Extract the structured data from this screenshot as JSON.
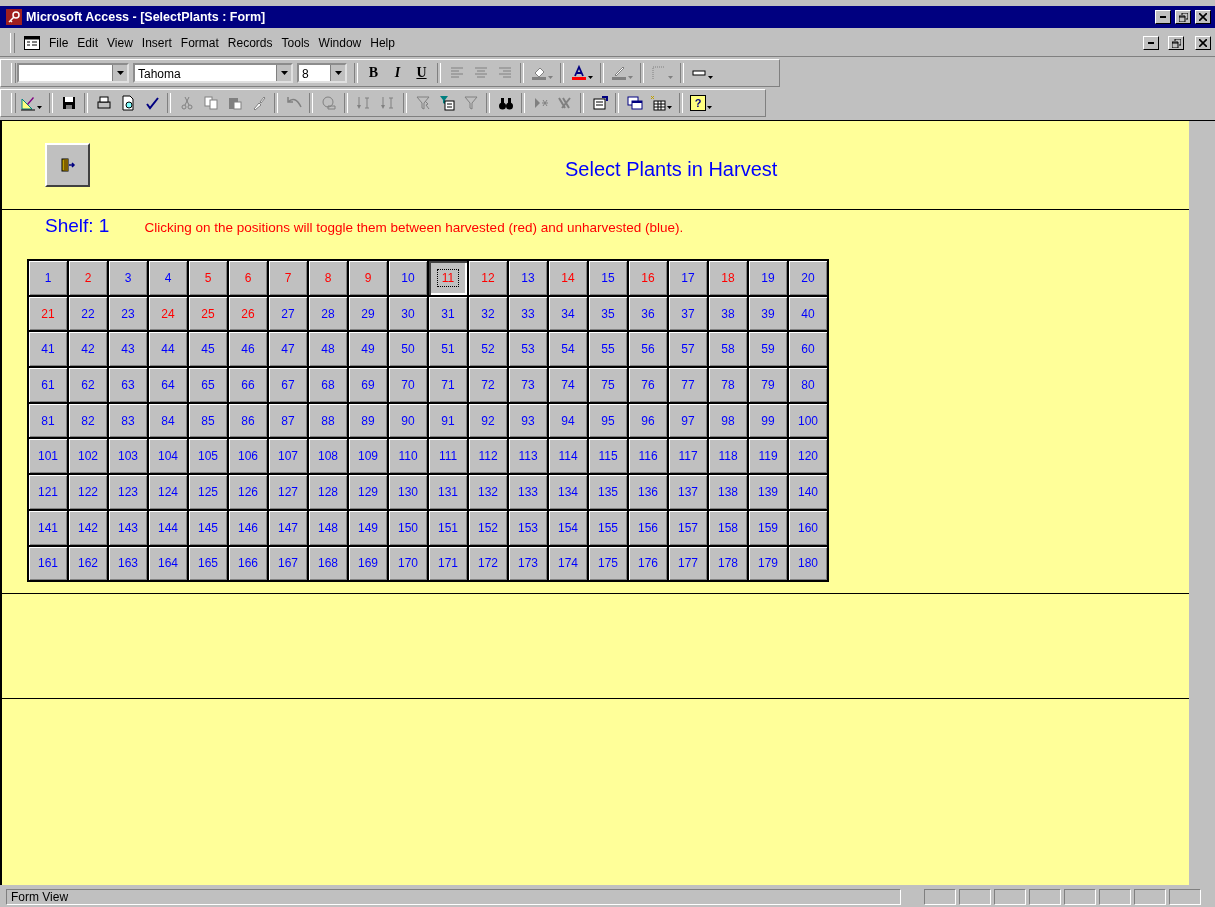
{
  "window": {
    "title": "Microsoft Access - [SelectPlants : Form]"
  },
  "menu": [
    "File",
    "Edit",
    "View",
    "Insert",
    "Format",
    "Records",
    "Tools",
    "Window",
    "Help"
  ],
  "formatting_toolbar": {
    "font_box": {
      "value": "Tahoma"
    },
    "size_box": {
      "value": "8"
    },
    "buttons": [
      {
        "kind": "bold",
        "glyph": "B",
        "disabled": false
      },
      {
        "kind": "italic",
        "glyph": "I",
        "disabled": false
      },
      {
        "kind": "underline",
        "glyph": "U",
        "disabled": false
      },
      {
        "kind": "separator"
      },
      {
        "kind": "align-left",
        "disabled": true
      },
      {
        "kind": "align-center",
        "disabled": true
      },
      {
        "kind": "align-right",
        "disabled": true
      },
      {
        "kind": "separator"
      },
      {
        "kind": "fill-color",
        "disabled": true
      },
      {
        "kind": "separator"
      },
      {
        "kind": "font-color",
        "disabled": false
      },
      {
        "kind": "separator"
      },
      {
        "kind": "line-color",
        "disabled": true
      },
      {
        "kind": "separator"
      },
      {
        "kind": "border",
        "disabled": true
      },
      {
        "kind": "separator"
      },
      {
        "kind": "special-effect",
        "disabled": false
      }
    ]
  },
  "form_toolbar": [
    {
      "kind": "view",
      "disabled": false
    },
    {
      "kind": "separator"
    },
    {
      "kind": "save",
      "disabled": false
    },
    {
      "kind": "separator"
    },
    {
      "kind": "print",
      "disabled": false
    },
    {
      "kind": "preview",
      "disabled": false
    },
    {
      "kind": "spelling",
      "disabled": false
    },
    {
      "kind": "separator"
    },
    {
      "kind": "cut",
      "disabled": true
    },
    {
      "kind": "copy",
      "disabled": true
    },
    {
      "kind": "paste",
      "disabled": true
    },
    {
      "kind": "brush",
      "disabled": true
    },
    {
      "kind": "separator"
    },
    {
      "kind": "undo",
      "disabled": true
    },
    {
      "kind": "separator"
    },
    {
      "kind": "hyperlink",
      "disabled": true
    },
    {
      "kind": "separator"
    },
    {
      "kind": "sort-ascending",
      "disabled": true
    },
    {
      "kind": "sort-descending",
      "disabled": true
    },
    {
      "kind": "separator"
    },
    {
      "kind": "filter-selection",
      "disabled": true
    },
    {
      "kind": "filter-form",
      "disabled": false
    },
    {
      "kind": "filter",
      "disabled": true
    },
    {
      "kind": "separator"
    },
    {
      "kind": "find",
      "disabled": false
    },
    {
      "kind": "separator"
    },
    {
      "kind": "new-record",
      "disabled": true
    },
    {
      "kind": "delete-record",
      "disabled": true
    },
    {
      "kind": "separator"
    },
    {
      "kind": "properties",
      "disabled": false
    },
    {
      "kind": "separator"
    },
    {
      "kind": "database-window",
      "disabled": false
    },
    {
      "kind": "new-object",
      "disabled": false
    },
    {
      "kind": "separator"
    },
    {
      "kind": "help",
      "glyph": "?",
      "disabled": false
    }
  ],
  "form": {
    "title": "Select Plants in Harvest",
    "shelf_label": "Shelf: 1",
    "instructions": "Clicking on the positions will toggle them between harvested (red) and unharvested (blue).",
    "positions": [
      {
        "label": "1",
        "harvested": false,
        "focused": false
      },
      {
        "label": "2",
        "harvested": true,
        "focused": false
      },
      {
        "label": "3",
        "harvested": false,
        "focused": false
      },
      {
        "label": "4",
        "harvested": false,
        "focused": false
      },
      {
        "label": "5",
        "harvested": true,
        "focused": false
      },
      {
        "label": "6",
        "harvested": true,
        "focused": false
      },
      {
        "label": "7",
        "harvested": true,
        "focused": false
      },
      {
        "label": "8",
        "harvested": true,
        "focused": false
      },
      {
        "label": "9",
        "harvested": true,
        "focused": false
      },
      {
        "label": "10",
        "harvested": false,
        "focused": false
      },
      {
        "label": "11",
        "harvested": true,
        "focused": true
      },
      {
        "label": "12",
        "harvested": true,
        "focused": false
      },
      {
        "label": "13",
        "harvested": false,
        "focused": false
      },
      {
        "label": "14",
        "harvested": true,
        "focused": false
      },
      {
        "label": "15",
        "harvested": false,
        "focused": false
      },
      {
        "label": "16",
        "harvested": true,
        "focused": false
      },
      {
        "label": "17",
        "harvested": false,
        "focused": false
      },
      {
        "label": "18",
        "harvested": true,
        "focused": false
      },
      {
        "label": "19",
        "harvested": false,
        "focused": false
      },
      {
        "label": "20",
        "harvested": false,
        "focused": false
      },
      {
        "label": "21",
        "harvested": true,
        "focused": false
      },
      {
        "label": "22",
        "harvested": false,
        "focused": false
      },
      {
        "label": "23",
        "harvested": false,
        "focused": false
      },
      {
        "label": "24",
        "harvested": true,
        "focused": false
      },
      {
        "label": "25",
        "harvested": true,
        "focused": false
      },
      {
        "label": "26",
        "harvested": true,
        "focused": false
      },
      {
        "label": "27",
        "harvested": false,
        "focused": false
      },
      {
        "label": "28",
        "harvested": false,
        "focused": false
      },
      {
        "label": "29",
        "harvested": false,
        "focused": false
      },
      {
        "label": "30",
        "harvested": false,
        "focused": false
      },
      {
        "label": "31",
        "harvested": false,
        "focused": false
      },
      {
        "label": "32",
        "harvested": false,
        "focused": false
      },
      {
        "label": "33",
        "harvested": false,
        "focused": false
      },
      {
        "label": "34",
        "harvested": false,
        "focused": false
      },
      {
        "label": "35",
        "harvested": false,
        "focused": false
      },
      {
        "label": "36",
        "harvested": false,
        "focused": false
      },
      {
        "label": "37",
        "harvested": false,
        "focused": false
      },
      {
        "label": "38",
        "harvested": false,
        "focused": false
      },
      {
        "label": "39",
        "harvested": false,
        "focused": false
      },
      {
        "label": "40",
        "harvested": false,
        "focused": false
      },
      {
        "label": "41",
        "harvested": false,
        "focused": false
      },
      {
        "label": "42",
        "harvested": false,
        "focused": false
      },
      {
        "label": "43",
        "harvested": false,
        "focused": false
      },
      {
        "label": "44",
        "harvested": false,
        "focused": false
      },
      {
        "label": "45",
        "harvested": false,
        "focused": false
      },
      {
        "label": "46",
        "harvested": false,
        "focused": false
      },
      {
        "label": "47",
        "harvested": false,
        "focused": false
      },
      {
        "label": "48",
        "harvested": false,
        "focused": false
      },
      {
        "label": "49",
        "harvested": false,
        "focused": false
      },
      {
        "label": "50",
        "harvested": false,
        "focused": false
      },
      {
        "label": "51",
        "harvested": false,
        "focused": false
      },
      {
        "label": "52",
        "harvested": false,
        "focused": false
      },
      {
        "label": "53",
        "harvested": false,
        "focused": false
      },
      {
        "label": "54",
        "harvested": false,
        "focused": false
      },
      {
        "label": "55",
        "harvested": false,
        "focused": false
      },
      {
        "label": "56",
        "harvested": false,
        "focused": false
      },
      {
        "label": "57",
        "harvested": false,
        "focused": false
      },
      {
        "label": "58",
        "harvested": false,
        "focused": false
      },
      {
        "label": "59",
        "harvested": false,
        "focused": false
      },
      {
        "label": "60",
        "harvested": false,
        "focused": false
      },
      {
        "label": "61",
        "harvested": false,
        "focused": false
      },
      {
        "label": "62",
        "harvested": false,
        "focused": false
      },
      {
        "label": "63",
        "harvested": false,
        "focused": false
      },
      {
        "label": "64",
        "harvested": false,
        "focused": false
      },
      {
        "label": "65",
        "harvested": false,
        "focused": false
      },
      {
        "label": "66",
        "harvested": false,
        "focused": false
      },
      {
        "label": "67",
        "harvested": false,
        "focused": false
      },
      {
        "label": "68",
        "harvested": false,
        "focused": false
      },
      {
        "label": "69",
        "harvested": false,
        "focused": false
      },
      {
        "label": "70",
        "harvested": false,
        "focused": false
      },
      {
        "label": "71",
        "harvested": false,
        "focused": false
      },
      {
        "label": "72",
        "harvested": false,
        "focused": false
      },
      {
        "label": "73",
        "harvested": false,
        "focused": false
      },
      {
        "label": "74",
        "harvested": false,
        "focused": false
      },
      {
        "label": "75",
        "harvested": false,
        "focused": false
      },
      {
        "label": "76",
        "harvested": false,
        "focused": false
      },
      {
        "label": "77",
        "harvested": false,
        "focused": false
      },
      {
        "label": "78",
        "harvested": false,
        "focused": false
      },
      {
        "label": "79",
        "harvested": false,
        "focused": false
      },
      {
        "label": "80",
        "harvested": false,
        "focused": false
      },
      {
        "label": "81",
        "harvested": false,
        "focused": false
      },
      {
        "label": "82",
        "harvested": false,
        "focused": false
      },
      {
        "label": "83",
        "harvested": false,
        "focused": false
      },
      {
        "label": "84",
        "harvested": false,
        "focused": false
      },
      {
        "label": "85",
        "harvested": false,
        "focused": false
      },
      {
        "label": "86",
        "harvested": false,
        "focused": false
      },
      {
        "label": "87",
        "harvested": false,
        "focused": false
      },
      {
        "label": "88",
        "harvested": false,
        "focused": false
      },
      {
        "label": "89",
        "harvested": false,
        "focused": false
      },
      {
        "label": "90",
        "harvested": false,
        "focused": false
      },
      {
        "label": "91",
        "harvested": false,
        "focused": false
      },
      {
        "label": "92",
        "harvested": false,
        "focused": false
      },
      {
        "label": "93",
        "harvested": false,
        "focused": false
      },
      {
        "label": "94",
        "harvested": false,
        "focused": false
      },
      {
        "label": "95",
        "harvested": false,
        "focused": false
      },
      {
        "label": "96",
        "harvested": false,
        "focused": false
      },
      {
        "label": "97",
        "harvested": false,
        "focused": false
      },
      {
        "label": "98",
        "harvested": false,
        "focused": false
      },
      {
        "label": "99",
        "harvested": false,
        "focused": false
      },
      {
        "label": "100",
        "harvested": false,
        "focused": false
      },
      {
        "label": "101",
        "harvested": false,
        "focused": false
      },
      {
        "label": "102",
        "harvested": false,
        "focused": false
      },
      {
        "label": "103",
        "harvested": false,
        "focused": false
      },
      {
        "label": "104",
        "harvested": false,
        "focused": false
      },
      {
        "label": "105",
        "harvested": false,
        "focused": false
      },
      {
        "label": "106",
        "harvested": false,
        "focused": false
      },
      {
        "label": "107",
        "harvested": false,
        "focused": false
      },
      {
        "label": "108",
        "harvested": false,
        "focused": false
      },
      {
        "label": "109",
        "harvested": false,
        "focused": false
      },
      {
        "label": "110",
        "harvested": false,
        "focused": false
      },
      {
        "label": "111",
        "harvested": false,
        "focused": false
      },
      {
        "label": "112",
        "harvested": false,
        "focused": false
      },
      {
        "label": "113",
        "harvested": false,
        "focused": false
      },
      {
        "label": "114",
        "harvested": false,
        "focused": false
      },
      {
        "label": "115",
        "harvested": false,
        "focused": false
      },
      {
        "label": "116",
        "harvested": false,
        "focused": false
      },
      {
        "label": "117",
        "harvested": false,
        "focused": false
      },
      {
        "label": "118",
        "harvested": false,
        "focused": false
      },
      {
        "label": "119",
        "harvested": false,
        "focused": false
      },
      {
        "label": "120",
        "harvested": false,
        "focused": false
      },
      {
        "label": "121",
        "harvested": false,
        "focused": false
      },
      {
        "label": "122",
        "harvested": false,
        "focused": false
      },
      {
        "label": "123",
        "harvested": false,
        "focused": false
      },
      {
        "label": "124",
        "harvested": false,
        "focused": false
      },
      {
        "label": "125",
        "harvested": false,
        "focused": false
      },
      {
        "label": "126",
        "harvested": false,
        "focused": false
      },
      {
        "label": "127",
        "harvested": false,
        "focused": false
      },
      {
        "label": "128",
        "harvested": false,
        "focused": false
      },
      {
        "label": "129",
        "harvested": false,
        "focused": false
      },
      {
        "label": "130",
        "harvested": false,
        "focused": false
      },
      {
        "label": "131",
        "harvested": false,
        "focused": false
      },
      {
        "label": "132",
        "harvested": false,
        "focused": false
      },
      {
        "label": "133",
        "harvested": false,
        "focused": false
      },
      {
        "label": "134",
        "harvested": false,
        "focused": false
      },
      {
        "label": "135",
        "harvested": false,
        "focused": false
      },
      {
        "label": "136",
        "harvested": false,
        "focused": false
      },
      {
        "label": "137",
        "harvested": false,
        "focused": false
      },
      {
        "label": "138",
        "harvested": false,
        "focused": false
      },
      {
        "label": "139",
        "harvested": false,
        "focused": false
      },
      {
        "label": "140",
        "harvested": false,
        "focused": false
      },
      {
        "label": "141",
        "harvested": false,
        "focused": false
      },
      {
        "label": "142",
        "harvested": false,
        "focused": false
      },
      {
        "label": "143",
        "harvested": false,
        "focused": false
      },
      {
        "label": "144",
        "harvested": false,
        "focused": false
      },
      {
        "label": "145",
        "harvested": false,
        "focused": false
      },
      {
        "label": "146",
        "harvested": false,
        "focused": false
      },
      {
        "label": "147",
        "harvested": false,
        "focused": false
      },
      {
        "label": "148",
        "harvested": false,
        "focused": false
      },
      {
        "label": "149",
        "harvested": false,
        "focused": false
      },
      {
        "label": "150",
        "harvested": false,
        "focused": false
      },
      {
        "label": "151",
        "harvested": false,
        "focused": false
      },
      {
        "label": "152",
        "harvested": false,
        "focused": false
      },
      {
        "label": "153",
        "harvested": false,
        "focused": false
      },
      {
        "label": "154",
        "harvested": false,
        "focused": false
      },
      {
        "label": "155",
        "harvested": false,
        "focused": false
      },
      {
        "label": "156",
        "harvested": false,
        "focused": false
      },
      {
        "label": "157",
        "harvested": false,
        "focused": false
      },
      {
        "label": "158",
        "harvested": false,
        "focused": false
      },
      {
        "label": "159",
        "harvested": false,
        "focused": false
      },
      {
        "label": "160",
        "harvested": false,
        "focused": false
      },
      {
        "label": "161",
        "harvested": false,
        "focused": false
      },
      {
        "label": "162",
        "harvested": false,
        "focused": false
      },
      {
        "label": "163",
        "harvested": false,
        "focused": false
      },
      {
        "label": "164",
        "harvested": false,
        "focused": false
      },
      {
        "label": "165",
        "harvested": false,
        "focused": false
      },
      {
        "label": "166",
        "harvested": false,
        "focused": false
      },
      {
        "label": "167",
        "harvested": false,
        "focused": false
      },
      {
        "label": "168",
        "harvested": false,
        "focused": false
      },
      {
        "label": "169",
        "harvested": false,
        "focused": false
      },
      {
        "label": "170",
        "harvested": false,
        "focused": false
      },
      {
        "label": "171",
        "harvested": false,
        "focused": false
      },
      {
        "label": "172",
        "harvested": false,
        "focused": false
      },
      {
        "label": "173",
        "harvested": false,
        "focused": false
      },
      {
        "label": "174",
        "harvested": false,
        "focused": false
      },
      {
        "label": "175",
        "harvested": false,
        "focused": false
      },
      {
        "label": "176",
        "harvested": false,
        "focused": false
      },
      {
        "label": "177",
        "harvested": false,
        "focused": false
      },
      {
        "label": "178",
        "harvested": false,
        "focused": false
      },
      {
        "label": "179",
        "harvested": false,
        "focused": false
      },
      {
        "label": "180",
        "harvested": false,
        "focused": false
      }
    ]
  },
  "status_bar": {
    "text": "Form View"
  }
}
